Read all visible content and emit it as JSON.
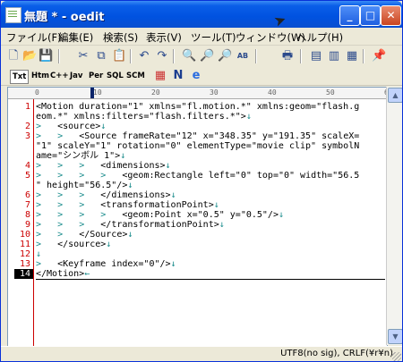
{
  "window": {
    "title": "無題 * - oedit",
    "min_label": "_",
    "max_label": "□",
    "close_label": "✕"
  },
  "menu": [
    "ファイル(F)",
    "編集(E)",
    "検索(S)",
    "表示(V)",
    "ツール(T)",
    "ウィンドウ(W)",
    "ヘルプ(H)"
  ],
  "toolbar_icons": [
    "new-file",
    "open-folder",
    "save",
    "cut",
    "copy",
    "paste",
    "undo",
    "redo",
    "find",
    "find-next",
    "find-prev",
    "replace",
    "print",
    "view-single",
    "view-split",
    "view-window",
    "pin"
  ],
  "lang_tabs": [
    "Txt",
    "Htm",
    "C++",
    "Jav",
    "Per",
    "SQL",
    "SCM"
  ],
  "active_lang": "Txt",
  "ruler": [
    "0",
    "10",
    "20",
    "30",
    "40",
    "50",
    "60"
  ],
  "lines": [
    {
      "n": "1",
      "text": "<Motion duration=\"1\" xmlns=\"fl.motion.*\" xmlns:geom=\"flash.g"
    },
    {
      "n": "",
      "text": "eom.*\" xmlns:filters=\"flash.filters.*\">"
    },
    {
      "n": "2",
      "tabs": 1,
      "text": "<source>"
    },
    {
      "n": "3",
      "tabs": 2,
      "text": "<Source frameRate=\"12\" x=\"348.35\" y=\"191.35\" scaleX="
    },
    {
      "n": "",
      "text": "\"1\" scaleY=\"1\" rotation=\"0\" elementType=\"movie clip\" symbolN"
    },
    {
      "n": "",
      "text": "ame=\"シンボル 1\">"
    },
    {
      "n": "4",
      "tabs": 3,
      "text": "<dimensions>"
    },
    {
      "n": "5",
      "tabs": 4,
      "text": "<geom:Rectangle left=\"0\" top=\"0\" width=\"56.5"
    },
    {
      "n": "",
      "text": "\" height=\"56.5\"/>"
    },
    {
      "n": "6",
      "tabs": 3,
      "text": "</dimensions>"
    },
    {
      "n": "7",
      "tabs": 3,
      "text": "<transformationPoint>"
    },
    {
      "n": "8",
      "tabs": 4,
      "text": "<geom:Point x=\"0.5\" y=\"0.5\"/>"
    },
    {
      "n": "9",
      "tabs": 3,
      "text": "</transformationPoint>"
    },
    {
      "n": "10",
      "tabs": 2,
      "text": "</Source>"
    },
    {
      "n": "11",
      "tabs": 1,
      "text": "</source>"
    },
    {
      "n": "12",
      "tabs": 0,
      "text": ""
    },
    {
      "n": "13",
      "tabs": 1,
      "text": "<Keyframe index=\"0\"/>"
    },
    {
      "n": "14",
      "tabs": 0,
      "text": "</Motion>",
      "current": true
    }
  ],
  "tab_glyph": ">",
  "eol_glyph": "↓",
  "eof_glyph": "←",
  "status": "UTF8(no sig), CRLF(¥r¥n)"
}
